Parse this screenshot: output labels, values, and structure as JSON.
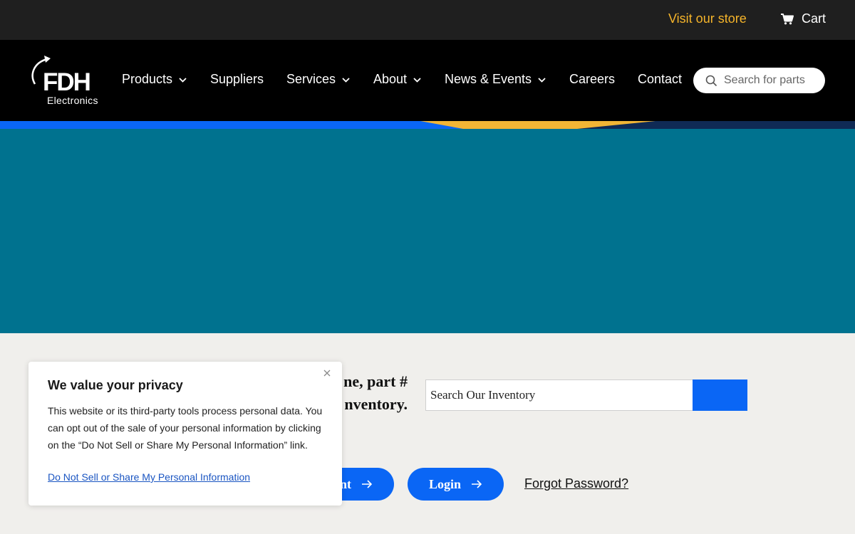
{
  "topbar": {
    "store_link": "Visit our store",
    "cart_label": "Cart",
    "store_color": "#f5b42a"
  },
  "logo": {
    "wordmark": "FDH",
    "subtitle": "Electronics"
  },
  "nav": {
    "products": "Products",
    "suppliers": "Suppliers",
    "services": "Services",
    "about": "About",
    "news_events": "News & Events",
    "careers": "Careers",
    "contact": "Contact",
    "search_placeholder": "Search for parts"
  },
  "inventory": {
    "heading_line1": "ne, part #",
    "heading_line2": "nventory.",
    "search_placeholder": "Search Our Inventory"
  },
  "account": {
    "create_label": "nt",
    "login_label": "Login",
    "forgot_label": "Forgot Password?"
  },
  "privacy": {
    "title": "We value your privacy",
    "body": "This website or its third-party tools process personal data. You can opt out of the sale of your personal information by clicking on the “Do Not Sell or Share My Personal Information” link.",
    "link": "Do Not Sell or Share My Personal Information"
  },
  "colors": {
    "hero": "#00728f",
    "accent_blue": "#0a66f5",
    "gold": "#f5b42a"
  }
}
